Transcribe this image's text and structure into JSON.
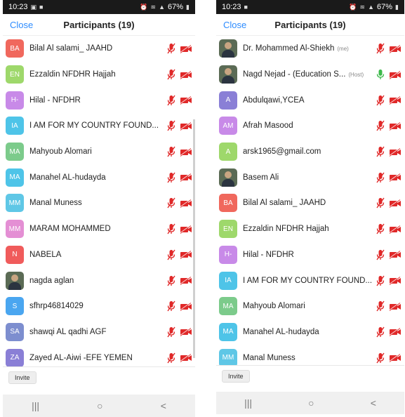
{
  "colors": {
    "accent": "#2d8cff",
    "muted_red": "#e02828",
    "mic_green": "#3cb94a"
  },
  "left": {
    "status": {
      "time": "10:23",
      "battery": "67%"
    },
    "header": {
      "close_label": "Close",
      "title": "Participants (19)"
    },
    "participants": [
      {
        "initials": "BA",
        "color": "#f0685d",
        "name": "Bilal Al salami_ JAAHD",
        "mic": "muted"
      },
      {
        "initials": "EN",
        "color": "#9ed86b",
        "name": "Ezzaldin NFDHR Hajjah",
        "mic": "muted"
      },
      {
        "initials": "H-",
        "color": "#c88ae8",
        "name": "Hilal - NFDHR",
        "mic": "muted"
      },
      {
        "initials": "IA",
        "color": "#4ec4e8",
        "name": "I AM FOR MY COUNTRY FOUND...",
        "mic": "muted"
      },
      {
        "initials": "MA",
        "color": "#7ccb8b",
        "name": "Mahyoub Alomari",
        "mic": "muted"
      },
      {
        "initials": "MA",
        "color": "#4ec4e8",
        "name": "Manahel AL-hudayda",
        "mic": "muted"
      },
      {
        "initials": "MM",
        "color": "#5fc7e6",
        "name": "Manal Muness",
        "mic": "muted"
      },
      {
        "initials": "MM",
        "color": "#e48fd4",
        "name": "MARAM MOHAMMED",
        "mic": "muted"
      },
      {
        "initials": "N",
        "color": "#f05b5b",
        "name": "NABELA",
        "mic": "muted"
      },
      {
        "initials": "",
        "color": "",
        "photo": true,
        "name": "nagda aglan",
        "mic": "muted"
      },
      {
        "initials": "S",
        "color": "#4aa6f0",
        "name": "sfhrp46814029",
        "mic": "muted"
      },
      {
        "initials": "SA",
        "color": "#7d8ecf",
        "name": "shawqi AL qadhi AGF",
        "mic": "muted"
      },
      {
        "initials": "ZA",
        "color": "#8a7fd6",
        "name": "Zayed AL-Aiwi -EFE YEMEN",
        "mic": "muted"
      }
    ],
    "invite_label": "Invite",
    "nav": {
      "recents": "|||",
      "home": "○",
      "back": "<"
    }
  },
  "right": {
    "status": {
      "time": "10:23",
      "battery": "67%"
    },
    "header": {
      "close_label": "Close",
      "title": "Participants (19)"
    },
    "participants": [
      {
        "initials": "",
        "color": "",
        "photo": true,
        "name": "Dr. Mohammed Al-Shiekh",
        "tag": "(me)",
        "mic": "muted"
      },
      {
        "initials": "",
        "color": "",
        "photo": true,
        "name": "Nagd Nejad - (Education S...",
        "tag": "(Host)",
        "mic": "active"
      },
      {
        "initials": "A",
        "color": "#8a7fd6",
        "name": "Abdulqawi,YCEA",
        "mic": "muted"
      },
      {
        "initials": "AM",
        "color": "#c88ae8",
        "name": "Afrah Masood",
        "mic": "muted"
      },
      {
        "initials": "A",
        "color": "#9ed86b",
        "name": "arsk1965@gmail.com",
        "mic": "muted"
      },
      {
        "initials": "",
        "color": "",
        "photo": true,
        "name": "Basem Ali",
        "mic": "muted"
      },
      {
        "initials": "BA",
        "color": "#f0685d",
        "name": "Bilal Al salami_ JAAHD",
        "mic": "muted"
      },
      {
        "initials": "EN",
        "color": "#9ed86b",
        "name": "Ezzaldin NFDHR Hajjah",
        "mic": "muted"
      },
      {
        "initials": "H-",
        "color": "#c88ae8",
        "name": "Hilal - NFDHR",
        "mic": "muted"
      },
      {
        "initials": "IA",
        "color": "#4ec4e8",
        "name": "I AM FOR MY COUNTRY FOUND...",
        "mic": "muted"
      },
      {
        "initials": "MA",
        "color": "#7ccb8b",
        "name": "Mahyoub Alomari",
        "mic": "muted"
      },
      {
        "initials": "MA",
        "color": "#4ec4e8",
        "name": "Manahel AL-hudayda",
        "mic": "muted"
      },
      {
        "initials": "MM",
        "color": "#5fc7e6",
        "name": "Manal Muness",
        "mic": "muted"
      }
    ],
    "invite_label": "Invite",
    "nav": {
      "recents": "|||",
      "home": "○",
      "back": "<"
    }
  }
}
